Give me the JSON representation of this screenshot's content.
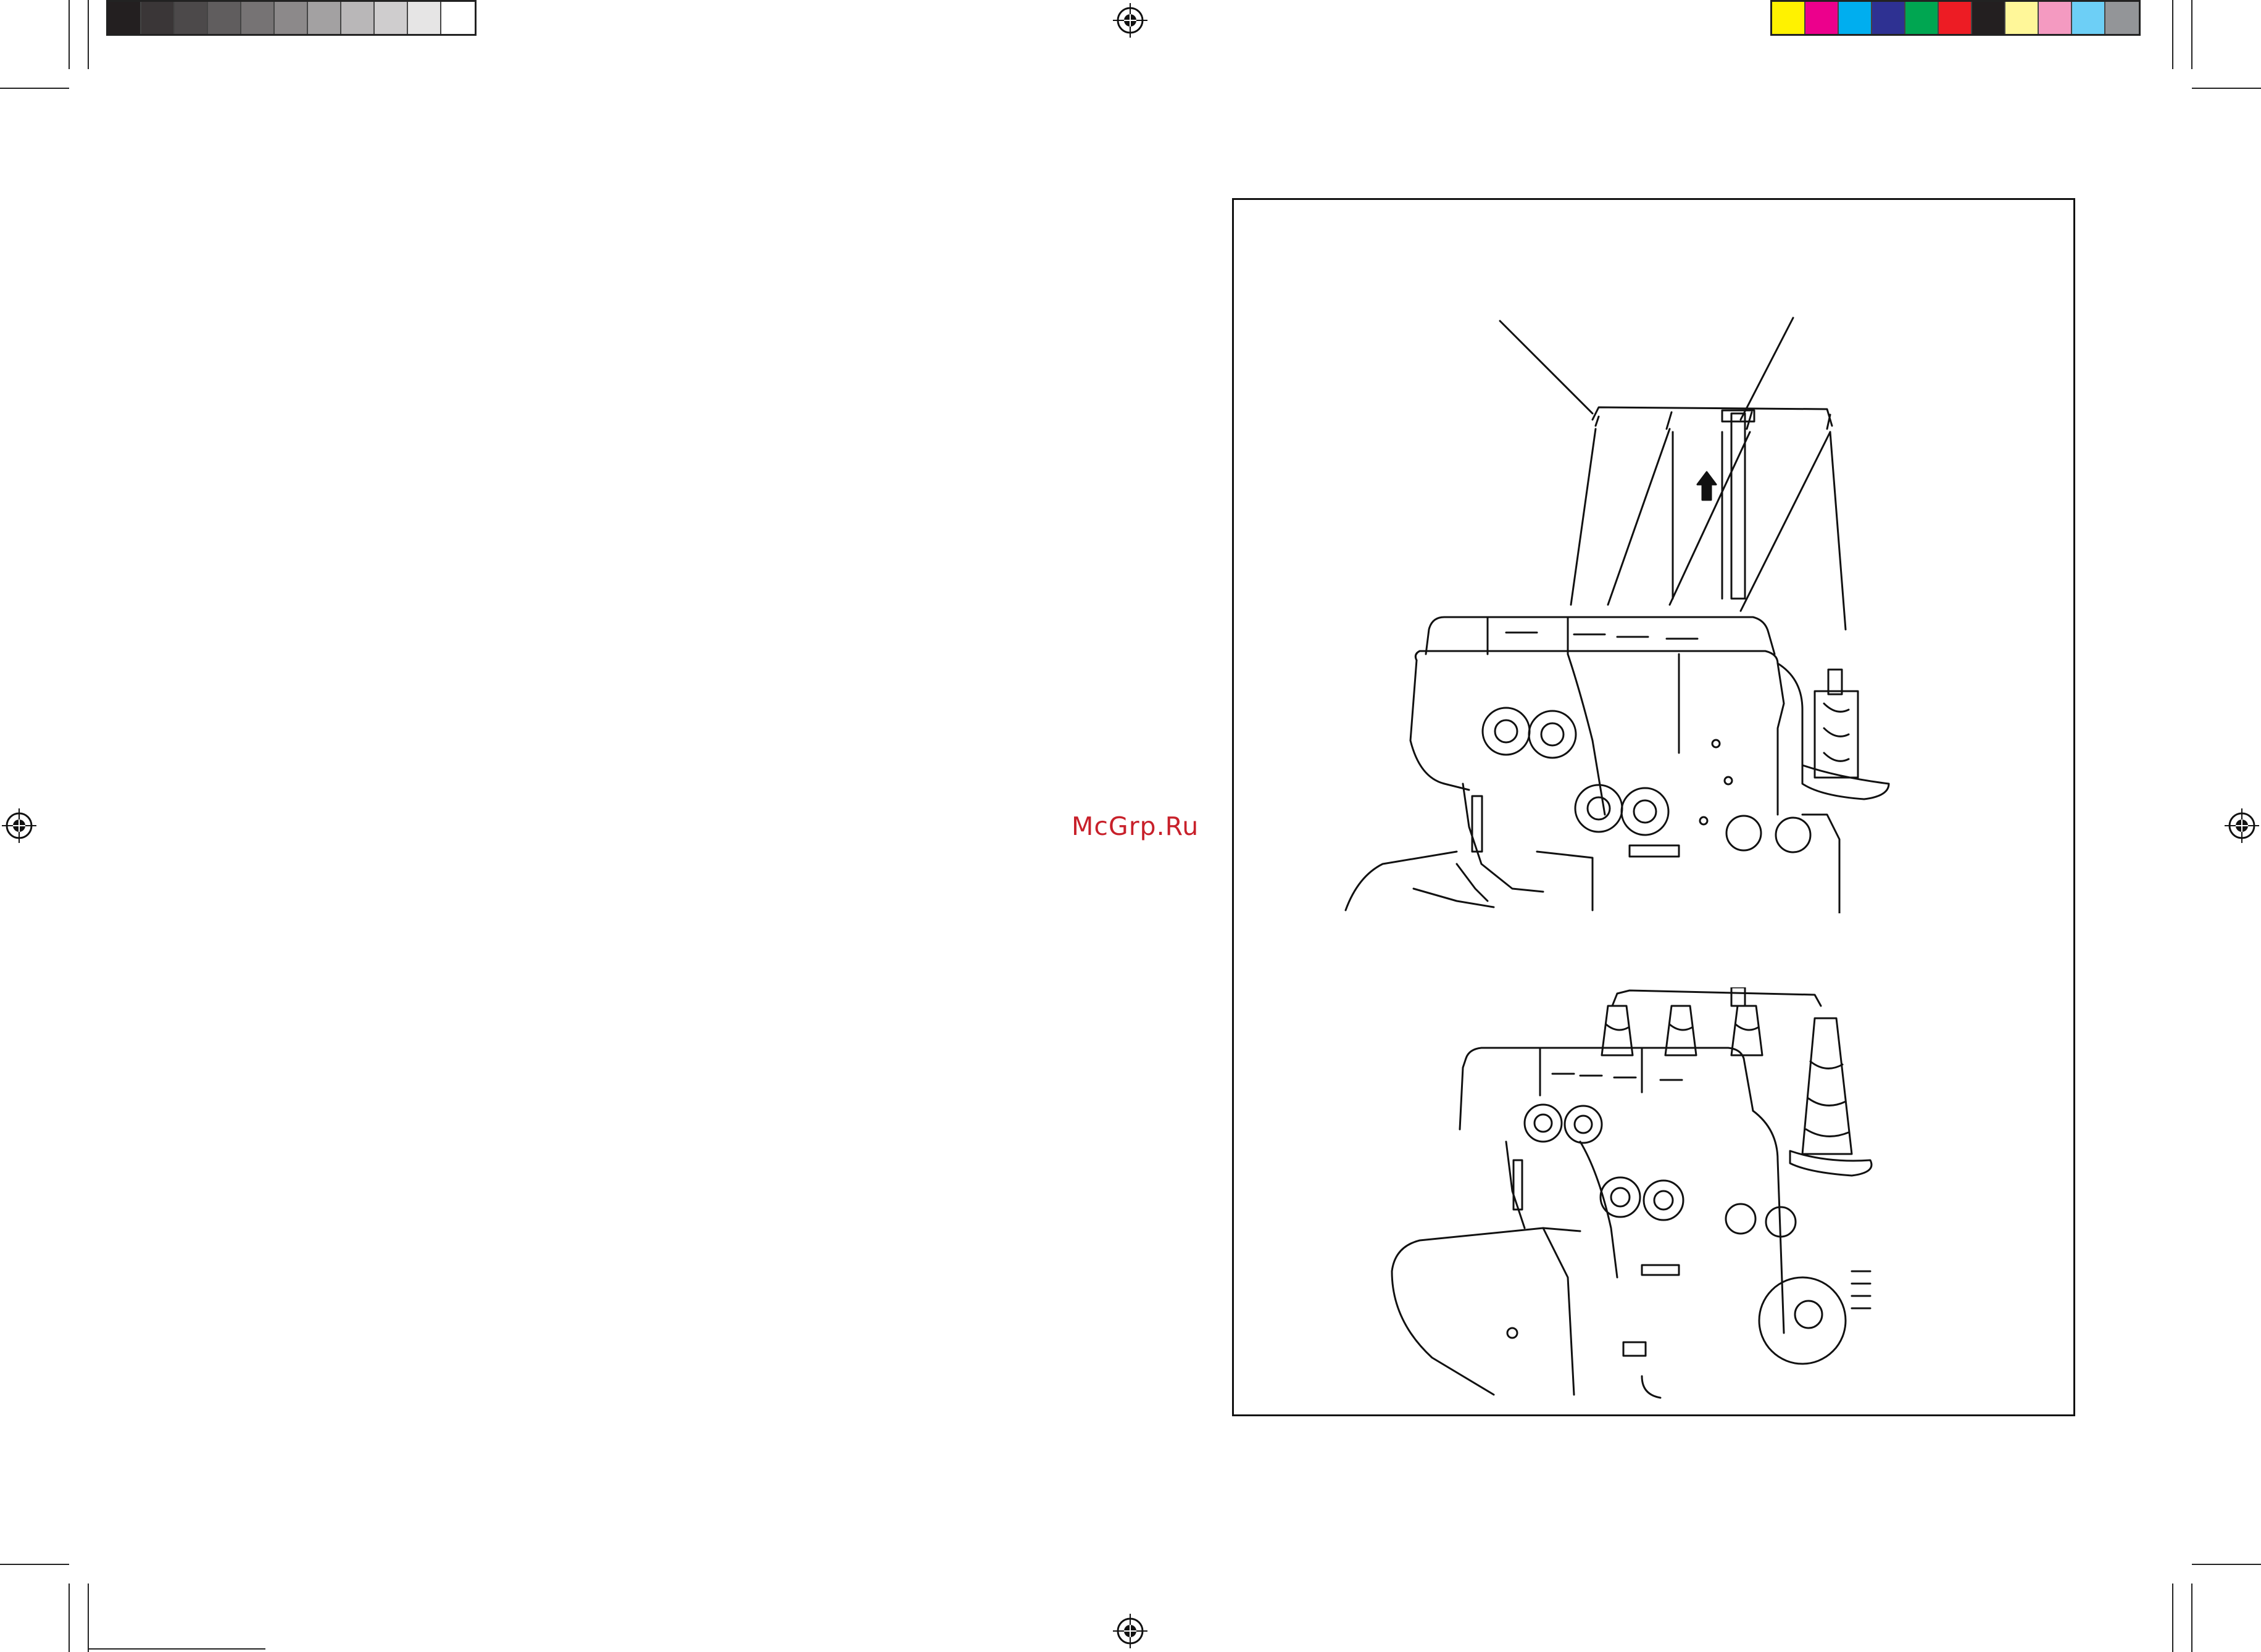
{
  "watermark": {
    "text": "McGrp.Ru",
    "color": "#c8202a"
  },
  "print_marks": {
    "gray_scale": [
      "#231f20",
      "#3a3637",
      "#4c494a",
      "#605d5e",
      "#767374",
      "#8c898a",
      "#a3a1a2",
      "#b9b7b8",
      "#cfcdce",
      "#e6e5e5",
      "#ffffff"
    ],
    "process_colors": [
      "#fff200",
      "#ec008c",
      "#00aeef",
      "#2e3192",
      "#00a651",
      "#ed1c24",
      "#231f20",
      "#fff799",
      "#f49ac1",
      "#6dcff6",
      "#939598"
    ]
  },
  "illustrations": [
    {
      "subject": "serger-machine-with-thread-guide-raised-icon"
    },
    {
      "subject": "serger-machine-with-four-thread-cones-icon"
    }
  ]
}
